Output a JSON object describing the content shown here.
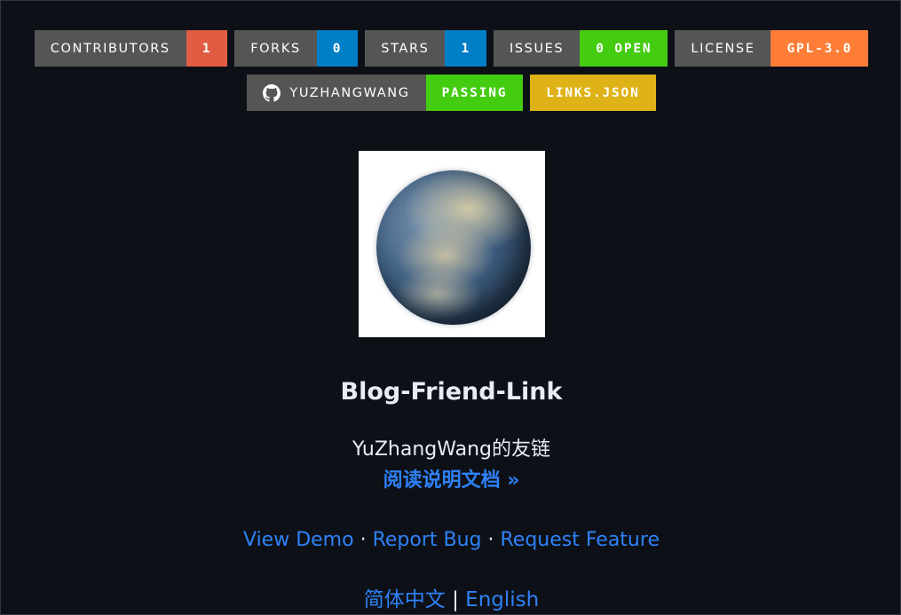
{
  "badges_row1": [
    {
      "label": "CONTRIBUTORS",
      "value": "1",
      "color": "#e05d44"
    },
    {
      "label": "FORKS",
      "value": "0",
      "color": "#007ec6"
    },
    {
      "label": "STARS",
      "value": "1",
      "color": "#007ec6"
    },
    {
      "label": "ISSUES",
      "value": "0 OPEN",
      "color": "#44cc11"
    },
    {
      "label": "LICENSE",
      "value": "GPL-3.0",
      "color": "#fe7d37"
    }
  ],
  "badges_row2": {
    "build": {
      "label": "YUZHANGWANG",
      "value": "PASSING",
      "color": "#44cc11",
      "icon": "github-icon"
    },
    "links": {
      "value": "LINKS.JSON",
      "color": "#dfb317"
    }
  },
  "title": "Blog-Friend-Link",
  "subtitle": "YuZhangWang的友链",
  "docs_link": "阅读说明文档 »",
  "actions": {
    "demo": "View Demo",
    "sep1": " · ",
    "bug": "Report Bug",
    "sep2": " · ",
    "feature": "Request Feature"
  },
  "languages": {
    "zh": "简体中文",
    "sep": " | ",
    "en": "English"
  }
}
